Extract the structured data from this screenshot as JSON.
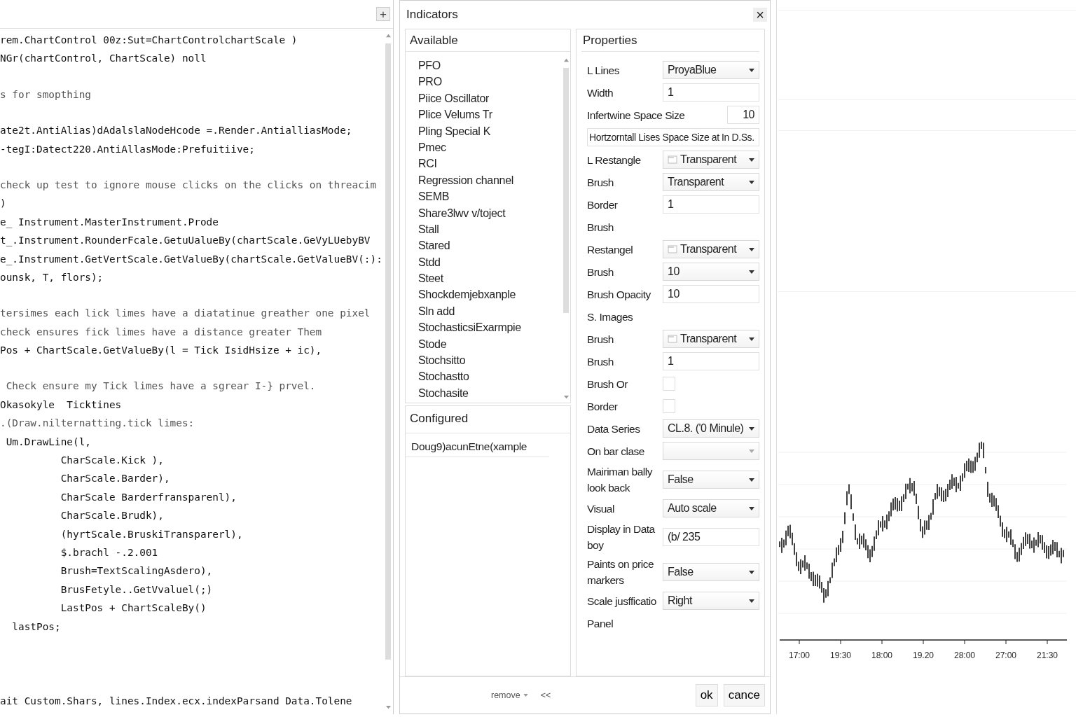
{
  "code_editor": {
    "add_button": "+",
    "blocks": [
      [
        {
          "kind": "code",
          "text": "rem.ChartControl 00z:Sut=ChartControlchartScale )"
        },
        {
          "kind": "code",
          "text": "NGr(chartControl, ChartScale) noll"
        }
      ],
      [
        {
          "kind": "comment",
          "text": "s for smopthing"
        }
      ],
      [
        {
          "kind": "code",
          "text": "ate2t.AntiAlias)dAdalslaNodeHcode =.Render.AntialliasMode;"
        },
        {
          "kind": "code",
          "text": "-tegI:Datect220.AntiAllasMode:Prefuitiive;"
        }
      ],
      [
        {
          "kind": "comment",
          "text": "check up test to ignore mouse clicks on the clicks on threacim"
        },
        {
          "kind": "code",
          "text": ")"
        },
        {
          "kind": "code",
          "text": "e_ Instrument.MasterInstrument.Prode"
        },
        {
          "kind": "code",
          "text": "t_.Instrument.RounderFcale.GetuUalueBy(chartScale.GeVyLUebyBV"
        },
        {
          "kind": "code",
          "text": "e_.Instrument.GetVertScale.GetValueBy(chartScale.GetValueBV(:):"
        },
        {
          "kind": "code",
          "text": "ounsk, T, flors);"
        }
      ],
      [
        {
          "kind": "comment",
          "text": "tersimes each lick limes have a diatatinue greather one pixel"
        },
        {
          "kind": "comment",
          "text": "check ensures fick limes have a distance greater Them"
        },
        {
          "kind": "code",
          "text": "Pos + ChartScale.GetValueBy(l = Tick IsidHsize + ic),"
        }
      ],
      [
        {
          "kind": "comment",
          "text": " Check ensure my Tick limes have a sgrear I-} prvel."
        },
        {
          "kind": "code",
          "text": "Okasokyle  Ticktines"
        },
        {
          "kind": "comment",
          "text": ".(Draw.nilternatting.tick limes:"
        },
        {
          "kind": "code",
          "text": " Um.DrawLine(l,"
        },
        {
          "kind": "code",
          "text": "          CharScale.Kick ),"
        },
        {
          "kind": "code",
          "text": "          CharScale.Barder),"
        },
        {
          "kind": "code",
          "text": "          CharScale Barderfransparenl),"
        },
        {
          "kind": "code",
          "text": "          CharScale.Brudk),"
        },
        {
          "kind": "code",
          "text": "          (hyrtScale.BruskiTransparerl),"
        },
        {
          "kind": "code",
          "text": "          $.brachl -.2.001"
        },
        {
          "kind": "code",
          "text": "          Brush=TextScalingAsdero),"
        },
        {
          "kind": "code",
          "text": "          BrusFetyle..GetVvaluel(;)"
        },
        {
          "kind": "code",
          "text": "          LastPos + ChartScaleBy()"
        },
        {
          "kind": "code",
          "text": "  lastPos;"
        }
      ]
    ],
    "bottom_line": "ait Custom.Shars, lines.Index.ecx.indexParsand Data.Tolene"
  },
  "dialog": {
    "title": "Indicators",
    "close": "×",
    "available": {
      "title": "Available",
      "items": [
        "PFO",
        "PRO",
        "Piice Oscillator",
        "Plice Velums Tr",
        "Pling Special K",
        "Pmec",
        "RCI",
        "Regression channel",
        "SEMB",
        "Share3lwv v/toject",
        "Stall",
        "Stared",
        "Stdd",
        "Steet",
        "Shockdemjebxanple",
        "Sln add",
        "StochasticsiExarmpie",
        "Stode",
        "Stochsitto",
        "Stochastto",
        "Stochasite"
      ]
    },
    "configured": {
      "title": "Configured",
      "items": [
        "Doug9)acunEtne(xample"
      ]
    },
    "properties": {
      "title": "Properties",
      "rows": [
        {
          "kind": "dropdown",
          "label": "L Lines",
          "value": "ProyaBlue",
          "swatch": false
        },
        {
          "kind": "input",
          "label": "Width",
          "value": "1"
        },
        {
          "kind": "short_input",
          "label": "Infertwine Space Size",
          "value": "10"
        },
        {
          "kind": "wide_input",
          "value": "Hortzorntall Lises Space Size at In D.Ss."
        },
        {
          "kind": "dropdown",
          "label": "L  Restangle",
          "value": "Transparent",
          "swatch": true
        },
        {
          "kind": "dropdown",
          "label": "Brush",
          "value": "Transparent",
          "swatch": false
        },
        {
          "kind": "input",
          "label": "Border",
          "value": "1"
        },
        {
          "kind": "heading",
          "label": "Brush"
        },
        {
          "kind": "dropdown",
          "label": "Restangel",
          "value": "Transparent",
          "swatch": true
        },
        {
          "kind": "dropdown",
          "label": "Brush",
          "value": "10",
          "swatch": false
        },
        {
          "kind": "input",
          "label": "Brush Opacity",
          "value": "10"
        },
        {
          "kind": "heading",
          "label": "S. Images"
        },
        {
          "kind": "dropdown",
          "label": "Brush",
          "value": "Transparent",
          "swatch": true
        },
        {
          "kind": "input",
          "label": "Brush",
          "value": "1"
        },
        {
          "kind": "checkbox",
          "label": "Brush Or",
          "checked": false
        },
        {
          "kind": "checkbox",
          "label": "Border",
          "checked": false
        },
        {
          "kind": "dropdown",
          "label": "Data Series",
          "value": "CL.8. ('0 Minule)",
          "swatch": false
        },
        {
          "kind": "dropdown",
          "label": "On bar clase",
          "swatch": false
        },
        {
          "kind": "dropdown",
          "label": "Mairiman bally look back",
          "value": "False",
          "swatch": false
        },
        {
          "kind": "dropdown",
          "label": "Visual",
          "value": "Auto scale",
          "swatch": false
        },
        {
          "kind": "input",
          "label": "Display in Data boy",
          "value": "(b/ 235"
        },
        {
          "kind": "dropdown",
          "label": "Paints on price markers",
          "value": "False",
          "swatch": false
        },
        {
          "kind": "dropdown",
          "label": "Scale jusfficatio",
          "value": "Right",
          "swatch": false
        },
        {
          "kind": "heading",
          "label": "Panel"
        }
      ]
    },
    "footer": {
      "remove": "remove",
      "move_left": "<<",
      "ok": "ok",
      "cancel": "cance"
    }
  },
  "chart": {
    "x_labels": [
      "17:00",
      "19:30",
      "18:00",
      "19.20",
      "28:00",
      "27:00",
      "21:30"
    ]
  }
}
